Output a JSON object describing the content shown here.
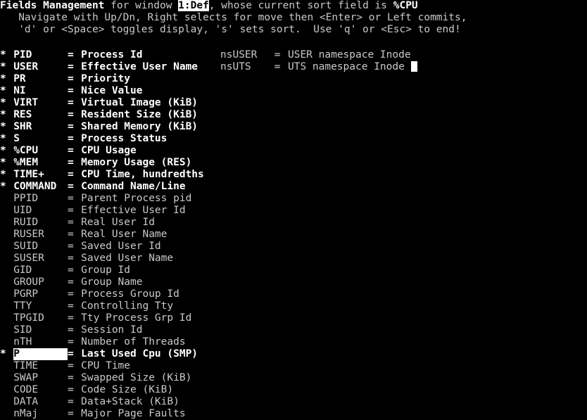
{
  "screen": {
    "background": "#000000",
    "foreground": "#d6d6d6",
    "highlight_bg": "#ffffff",
    "highlight_fg": "#000000"
  },
  "header": {
    "line1": {
      "title": "Fields Management",
      "mid": " for window ",
      "window": "1:Def",
      "tail": ", whose current sort field is ",
      "sort_field": "%CPU"
    },
    "line2": "   Navigate with Up/Dn, Right selects for move then <Enter> or Left commits,",
    "line3": "   'd' or <Space> toggles display, 's' sets sort.  Use 'q' or <Esc> to end!"
  },
  "left_column": {
    "rows": [
      {
        "star": "*",
        "name": "PID",
        "eq": "=",
        "desc": "Process Id",
        "on": true,
        "selected": false
      },
      {
        "star": "*",
        "name": "USER",
        "eq": "=",
        "desc": "Effective User Name",
        "on": true,
        "selected": false
      },
      {
        "star": "*",
        "name": "PR",
        "eq": "=",
        "desc": "Priority",
        "on": true,
        "selected": false
      },
      {
        "star": "*",
        "name": "NI",
        "eq": "=",
        "desc": "Nice Value",
        "on": true,
        "selected": false
      },
      {
        "star": "*",
        "name": "VIRT",
        "eq": "=",
        "desc": "Virtual Image (KiB)",
        "on": true,
        "selected": false
      },
      {
        "star": "*",
        "name": "RES",
        "eq": "=",
        "desc": "Resident Size (KiB)",
        "on": true,
        "selected": false
      },
      {
        "star": "*",
        "name": "SHR",
        "eq": "=",
        "desc": "Shared Memory (KiB)",
        "on": true,
        "selected": false
      },
      {
        "star": "*",
        "name": "S",
        "eq": "=",
        "desc": "Process Status",
        "on": true,
        "selected": false
      },
      {
        "star": "*",
        "name": "%CPU",
        "eq": "=",
        "desc": "CPU Usage",
        "on": true,
        "selected": false
      },
      {
        "star": "*",
        "name": "%MEM",
        "eq": "=",
        "desc": "Memory Usage (RES)",
        "on": true,
        "selected": false
      },
      {
        "star": "*",
        "name": "TIME+",
        "eq": "=",
        "desc": "CPU Time, hundredths",
        "on": true,
        "selected": false
      },
      {
        "star": "*",
        "name": "COMMAND",
        "eq": "=",
        "desc": "Command Name/Line",
        "on": true,
        "selected": false
      },
      {
        "star": " ",
        "name": "PPID",
        "eq": "=",
        "desc": "Parent Process pid",
        "on": false,
        "selected": false
      },
      {
        "star": " ",
        "name": "UID",
        "eq": "=",
        "desc": "Effective User Id",
        "on": false,
        "selected": false
      },
      {
        "star": " ",
        "name": "RUID",
        "eq": "=",
        "desc": "Real User Id",
        "on": false,
        "selected": false
      },
      {
        "star": " ",
        "name": "RUSER",
        "eq": "=",
        "desc": "Real User Name",
        "on": false,
        "selected": false
      },
      {
        "star": " ",
        "name": "SUID",
        "eq": "=",
        "desc": "Saved User Id",
        "on": false,
        "selected": false
      },
      {
        "star": " ",
        "name": "SUSER",
        "eq": "=",
        "desc": "Saved User Name",
        "on": false,
        "selected": false
      },
      {
        "star": " ",
        "name": "GID",
        "eq": "=",
        "desc": "Group Id",
        "on": false,
        "selected": false
      },
      {
        "star": " ",
        "name": "GROUP",
        "eq": "=",
        "desc": "Group Name",
        "on": false,
        "selected": false
      },
      {
        "star": " ",
        "name": "PGRP",
        "eq": "=",
        "desc": "Process Group Id",
        "on": false,
        "selected": false
      },
      {
        "star": " ",
        "name": "TTY",
        "eq": "=",
        "desc": "Controlling Tty",
        "on": false,
        "selected": false
      },
      {
        "star": " ",
        "name": "TPGID",
        "eq": "=",
        "desc": "Tty Process Grp Id",
        "on": false,
        "selected": false
      },
      {
        "star": " ",
        "name": "SID",
        "eq": "=",
        "desc": "Session Id",
        "on": false,
        "selected": false
      },
      {
        "star": " ",
        "name": "nTH",
        "eq": "=",
        "desc": "Number of Threads",
        "on": false,
        "selected": false
      },
      {
        "star": "*",
        "name": "P",
        "eq": "=",
        "desc": "Last Used Cpu (SMP)",
        "on": true,
        "selected": true
      },
      {
        "star": " ",
        "name": "TIME",
        "eq": "=",
        "desc": "CPU Time",
        "on": false,
        "selected": false
      },
      {
        "star": " ",
        "name": "SWAP",
        "eq": "=",
        "desc": "Swapped Size (KiB)",
        "on": false,
        "selected": false
      },
      {
        "star": " ",
        "name": "CODE",
        "eq": "=",
        "desc": "Code Size (KiB)",
        "on": false,
        "selected": false
      },
      {
        "star": " ",
        "name": "DATA",
        "eq": "=",
        "desc": "Data+Stack (KiB)",
        "on": false,
        "selected": false
      },
      {
        "star": " ",
        "name": "nMaj",
        "eq": "=",
        "desc": "Major Page Faults",
        "on": false,
        "selected": false
      }
    ]
  },
  "right_column": {
    "rows": [
      {
        "name": "nsUSER",
        "eq": "=",
        "desc": "USER namespace Inode",
        "cursor": false
      },
      {
        "name": "nsUTS",
        "eq": "=",
        "desc": "UTS namespace Inode",
        "cursor": true
      }
    ]
  }
}
